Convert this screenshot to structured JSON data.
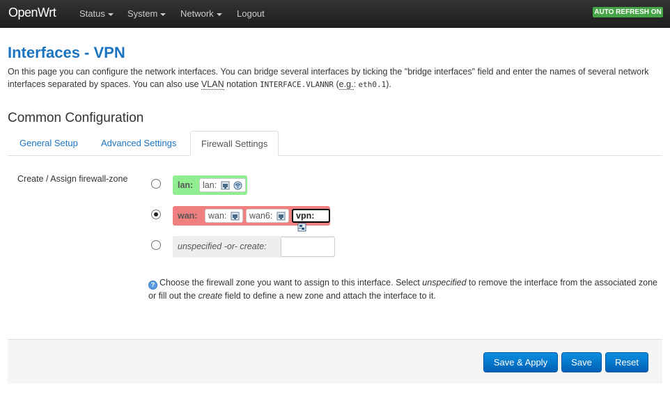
{
  "topbar": {
    "brand": "OpenWrt",
    "menu": [
      {
        "label": "Status",
        "has_dropdown": true
      },
      {
        "label": "System",
        "has_dropdown": true
      },
      {
        "label": "Network",
        "has_dropdown": true
      },
      {
        "label": "Logout",
        "has_dropdown": false
      }
    ],
    "auto_refresh": "AUTO REFRESH ON",
    "auto_refresh_color": "#46a546"
  },
  "page": {
    "title": "Interfaces - VPN",
    "intro_1": "On this page you can configure the network interfaces. You can bridge several interfaces by ticking the \"bridge interfaces\" field and enter the names of several network interfaces separated by spaces. You can also use ",
    "intro_vlan": "VLAN",
    "intro_2": " notation ",
    "intro_code1": "INTERFACE.VLANNR",
    "intro_3": " (",
    "intro_eg": "e.g.",
    "intro_4": ": ",
    "intro_code2": "eth0.1",
    "intro_5": ")."
  },
  "section": {
    "title": "Common Configuration",
    "tabs": [
      {
        "label": "General Setup",
        "active": false
      },
      {
        "label": "Advanced Settings",
        "active": false
      },
      {
        "label": "Firewall Settings",
        "active": true
      }
    ]
  },
  "firewall": {
    "label": "Create / Assign firewall-zone",
    "zones": [
      {
        "name": "lan:",
        "color": "#90ee90",
        "selected": false,
        "interfaces": [
          {
            "label": "lan:",
            "icon": "ethernet-icon"
          },
          {
            "label": "",
            "icon": "wifi-icon"
          }
        ]
      },
      {
        "name": "wan:",
        "color": "#f08080",
        "selected": true,
        "interfaces": [
          {
            "label": "wan:",
            "icon": "ethernet-icon"
          },
          {
            "label": "wan6:",
            "icon": "ethernet-icon"
          },
          {
            "label": "vpn:",
            "icon": "tunnel-icon",
            "current": true
          }
        ]
      }
    ],
    "new_zone": {
      "label": "unspecified -or- create:",
      "value": ""
    },
    "help_1": "Choose the firewall zone you want to assign to this interface. Select ",
    "help_unspecified": "unspecified",
    "help_2": " to remove the interface from the associated zone or fill out the ",
    "help_create": "create",
    "help_3": " field to define a new zone and attach the interface to it."
  },
  "actions": {
    "save_apply": "Save & Apply",
    "save": "Save",
    "reset": "Reset",
    "button_color": "#0069c0"
  }
}
